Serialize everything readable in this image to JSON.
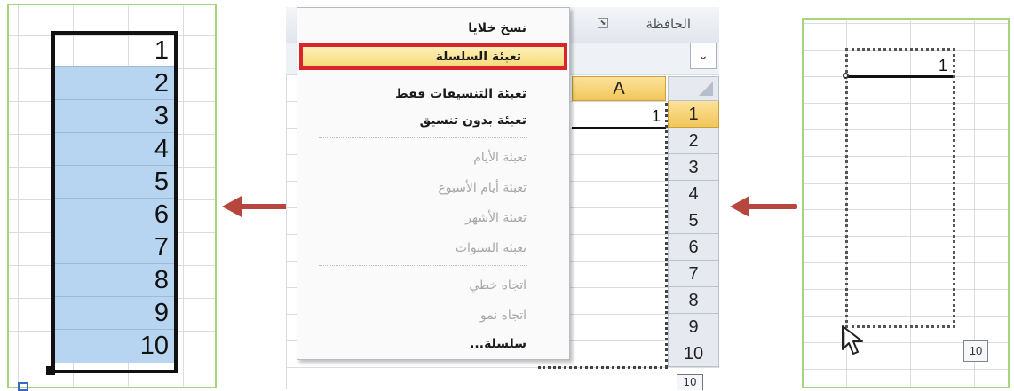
{
  "left_panel": {
    "values": [
      "1",
      "2",
      "3",
      "4",
      "5",
      "6",
      "7",
      "8",
      "9",
      "10"
    ]
  },
  "center_panel": {
    "ribbon_clipboard_label": "الحافظة",
    "column_header": "A",
    "row_numbers": [
      "1",
      "2",
      "3",
      "4",
      "5",
      "6",
      "7",
      "8",
      "9",
      "10"
    ],
    "cell_a1_value": "1",
    "partial_badge": "10",
    "fill_menu": {
      "items": [
        {
          "label": "نسخ خلايا",
          "state": "enabled"
        },
        {
          "label": "تعبئة السلسلة",
          "state": "highlighted"
        },
        {
          "label": "تعبئة التنسيقات فقط",
          "state": "enabled"
        },
        {
          "label": "تعبئة بدون تنسيق",
          "state": "enabled"
        },
        {
          "label": "تعبئة الأيام",
          "state": "disabled"
        },
        {
          "label": "تعبئة أيام الأسبوع",
          "state": "disabled"
        },
        {
          "label": "تعبئة الأشهر",
          "state": "disabled"
        },
        {
          "label": "تعبئة السنوات",
          "state": "disabled"
        },
        {
          "label": "اتجاه خطي",
          "state": "disabled"
        },
        {
          "label": "اتجاه نمو",
          "state": "disabled"
        },
        {
          "label": "سلسلة...",
          "state": "enabled"
        }
      ]
    }
  },
  "right_panel": {
    "cell_a1_value": "1",
    "fill_count_badge": "10"
  },
  "colors": {
    "panel_border": "#a6d47c",
    "selection_fill": "#b7d4f0",
    "arrow": "#b5473e",
    "highlight_border": "#d8242a",
    "header_active": "#f2c659"
  },
  "icons": {
    "arrows": "left-arrow-icon",
    "cursor": "mouse-pointer-icon",
    "dropdown": "chevron-down-icon"
  }
}
